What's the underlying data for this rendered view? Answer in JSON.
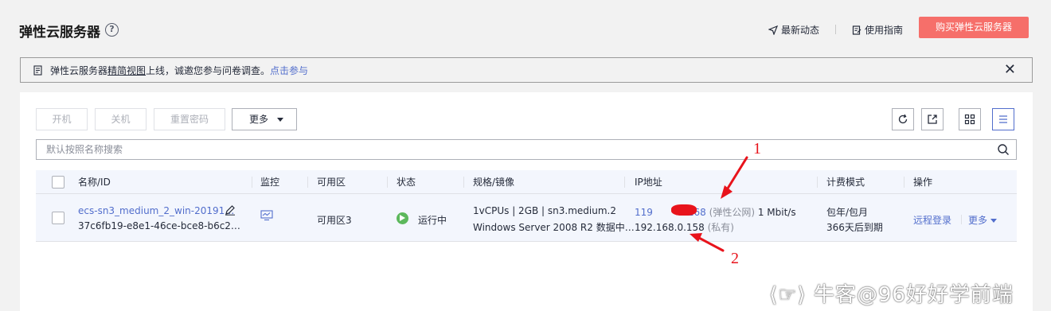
{
  "header": {
    "title": "弹性云服务器",
    "help_icon": "question-circle-icon",
    "latest_news": "最新动态",
    "user_guide": "使用指南",
    "buy_button": "购买弹性云服务器"
  },
  "notice": {
    "text_before": "弹性云服务器",
    "underlined": "精简视图",
    "text_after": "上线，诚邀您参与问卷调查。",
    "link": "点击参与"
  },
  "toolbar": {
    "power_on": "开机",
    "power_off": "关机",
    "reset_password": "重置密码",
    "more": "更多"
  },
  "search": {
    "placeholder": "默认按照名称搜索"
  },
  "table": {
    "headers": {
      "name": "名称/ID",
      "monitor": "监控",
      "az": "可用区",
      "status": "状态",
      "spec": "规格/镜像",
      "ip": "IP地址",
      "billing": "计费模式",
      "actions": "操作"
    },
    "rows": [
      {
        "name": "ecs-sn3_medium_2_win-20191…",
        "id": "37c6fb19-e8e1-46ce-bce8-b6c2…",
        "az": "可用区3",
        "status": "运行中",
        "spec": "1vCPUs | 2GB | sn3.medium.2",
        "image": "Windows Server 2008 R2 数据中…",
        "ip_public_prefix": "119",
        "ip_public_suffix": "168",
        "ip_public_tag": "(弹性公网)",
        "ip_bandwidth": "1 Mbit/s",
        "ip_private": "192.168.0.158",
        "ip_private_tag": "(私有)",
        "billing": "包年/包月",
        "expiry": "366天后到期",
        "remote_login": "远程登录",
        "more": "更多"
      }
    ]
  },
  "annotations": {
    "label_1": "1",
    "label_2": "2"
  },
  "watermark": "⟨☞⟩ 牛客@96好好学前端",
  "colors": {
    "buy_button": "#f66f6a",
    "link": "#526ecc",
    "status_running": "#5cb85c",
    "annotation_red": "#e8131b"
  }
}
